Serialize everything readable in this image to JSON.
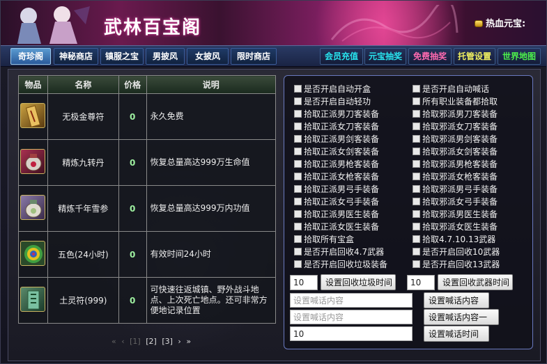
{
  "header": {
    "title": "武林百宝阁",
    "wallet_label": "热血元宝:"
  },
  "nav": {
    "left": [
      "奇珍阁",
      "神秘商店",
      "镇服之宝",
      "男披风",
      "女披风",
      "限时商店"
    ],
    "right": [
      "会员充值",
      "元宝抽奖",
      "免费抽奖",
      "托管设置",
      "世界地图"
    ]
  },
  "table": {
    "headers": [
      "物品",
      "名称",
      "价格",
      "说明"
    ],
    "rows": [
      {
        "name": "无极金尊符",
        "price": "0",
        "desc": "永久免费",
        "icon": "golden-talisman-icon"
      },
      {
        "name": "精炼九转丹",
        "price": "0",
        "desc": "恢复总量高达999万生命值",
        "icon": "pill-jar-icon"
      },
      {
        "name": "精炼千年雪参",
        "price": "0",
        "desc": "恢复总量高达999万内功值",
        "icon": "ginseng-jar-icon"
      },
      {
        "name": "五色(24小时)",
        "price": "0",
        "desc": "有效时间24小时",
        "icon": "rainbow-orb-icon"
      },
      {
        "name": "土灵符(999)",
        "price": "0",
        "desc": "可快速往返城镇、野外战斗地点、上次死亡地点。还可非常方便地记录位置",
        "icon": "jade-talisman-icon"
      }
    ]
  },
  "pager": {
    "prev": "«",
    "prev_one": "‹",
    "p1": "[1]",
    "p2": "[2]",
    "p3": "[3]",
    "next_one": "›",
    "next": "»"
  },
  "settings": {
    "options_left": [
      "是否开启自动开盒",
      "是否开启自动轻功",
      "拾取正派男刀客装备",
      "拾取正派女刀客装备",
      "拾取正派男剑客装备",
      "拾取正派女剑客装备",
      "拾取正派男枪客装备",
      "拾取正派女枪客装备",
      "拾取正派男弓手装备",
      "拾取正派女弓手装备",
      "拾取正派男医生装备",
      "拾取正派女医生装备",
      "拾取所有宝盒",
      "是否开启回收4.7武器",
      "是否开启回收垃圾装备"
    ],
    "options_right": [
      "是否开启自动喊话",
      "所有职业装备都拾取",
      "拾取邪派男刀客装备",
      "拾取邪派女刀客装备",
      "拾取邪派男剑客装备",
      "拾取邪派女剑客装备",
      "拾取邪派男枪客装备",
      "拾取邪派女枪客装备",
      "拾取邪派男弓手装备",
      "拾取邪派女弓手装备",
      "拾取邪派男医生装备",
      "拾取邪派女医生装备",
      "拾取4.7.10.13武器",
      "是否开启回收10武器",
      "是否开启回收13武器"
    ],
    "recycle_junk_value": "10",
    "recycle_junk_button": "设置回收垃圾时间",
    "recycle_weapon_value": "10",
    "recycle_weapon_button": "设置回收武器时间",
    "shout_placeholder_1": "设置喊话内容",
    "shout_button_1": "设置喊话内容",
    "shout_placeholder_2": "设置喊话内容",
    "shout_button_2": "设置喊话内容一",
    "shout_time_value": "10",
    "shout_time_button": "设置喊话时间"
  },
  "colors": {
    "active_tab": "#2a5a9a",
    "price": "#9ef0a0",
    "panel_border": "#6a7ac0",
    "banner": "#7a1e5e"
  }
}
